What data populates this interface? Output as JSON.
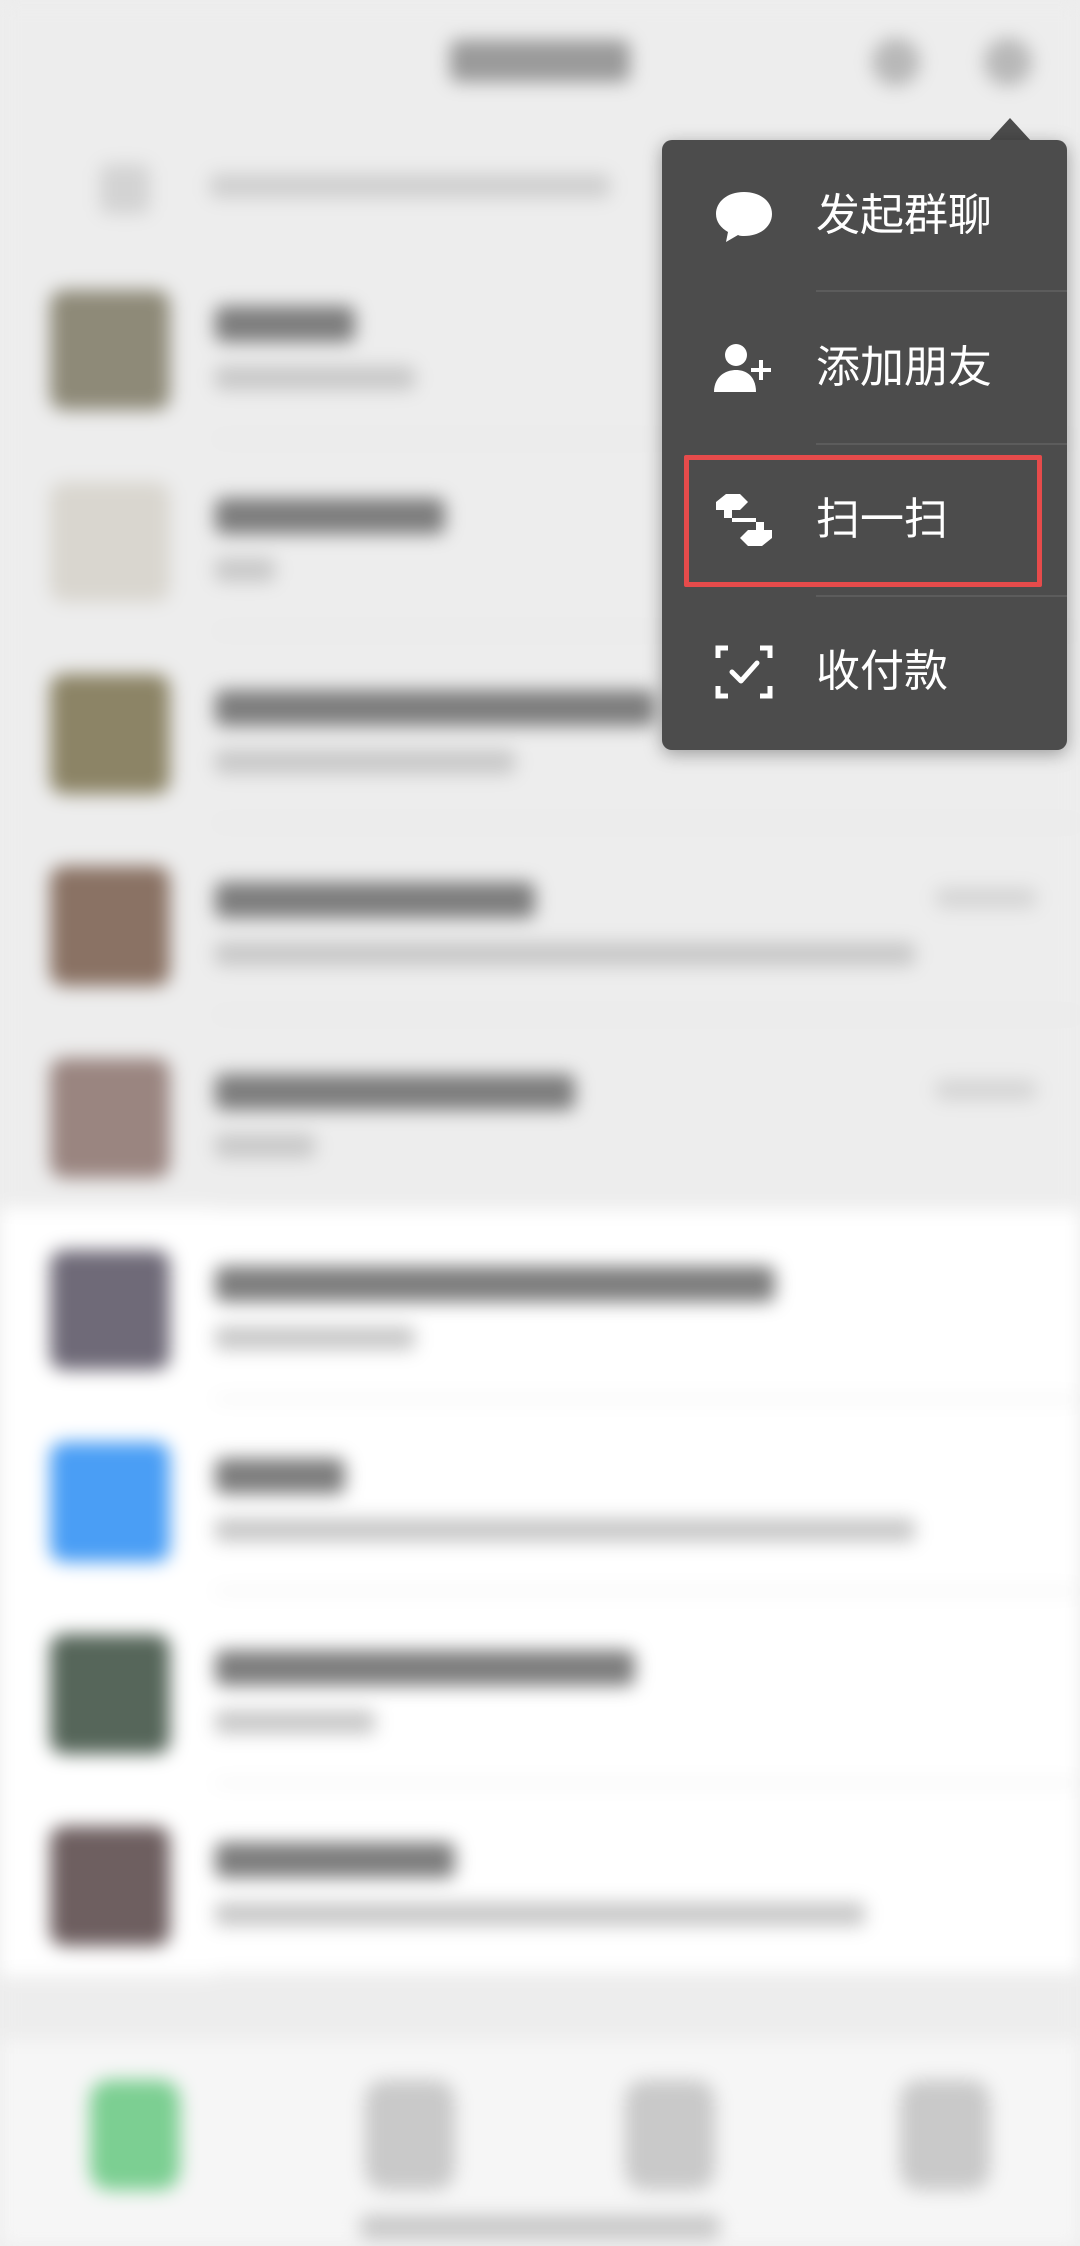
{
  "menu": {
    "items": [
      {
        "label": "发起群聊",
        "icon": "chat-bubble-icon"
      },
      {
        "label": "添加朋友",
        "icon": "add-friend-icon"
      },
      {
        "label": "扫一扫",
        "icon": "scan-icon"
      },
      {
        "label": "收付款",
        "icon": "payment-scan-icon"
      }
    ],
    "highlighted_item": "扫一扫"
  },
  "colors": {
    "menu_background": "#4c4c4c",
    "menu_text": "#ffffff",
    "highlight_border": "#e64b4b",
    "page_background": "#ededed"
  }
}
